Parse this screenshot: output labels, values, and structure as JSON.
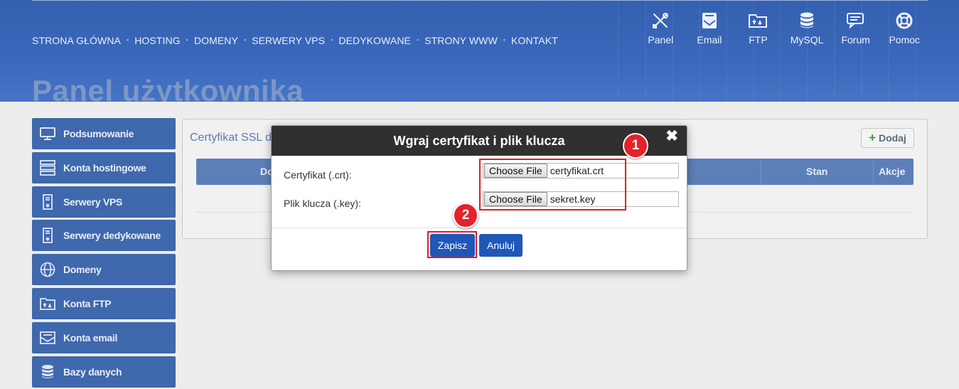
{
  "header": {
    "nav": [
      "STRONA GŁÓWNA",
      "HOSTING",
      "DOMENY",
      "SERWERY VPS",
      "DEDYKOWANE",
      "STRONY WWW",
      "KONTAKT"
    ],
    "nav_separator": "▪",
    "tools": [
      {
        "label": "Panel",
        "icon": "tools-icon"
      },
      {
        "label": "Email",
        "icon": "email-icon"
      },
      {
        "label": "FTP",
        "icon": "ftp-folder-icon"
      },
      {
        "label": "MySQL",
        "icon": "database-icon"
      },
      {
        "label": "Forum",
        "icon": "forum-icon"
      },
      {
        "label": "Pomoc",
        "icon": "lifebuoy-icon"
      }
    ],
    "page_title": "Panel użytkownika"
  },
  "sidebar": {
    "items": [
      {
        "label": "Podsumowanie",
        "icon": "monitor-icon"
      },
      {
        "label": "Konta hostingowe",
        "icon": "server-stack-icon"
      },
      {
        "label": "Serwery VPS",
        "icon": "server-tower-icon"
      },
      {
        "label": "Serwery dedykowane",
        "icon": "server-tower-icon"
      },
      {
        "label": "Domeny",
        "icon": "www-globe-icon"
      },
      {
        "label": "Konta FTP",
        "icon": "ftp-folder-icon"
      },
      {
        "label": "Konta email",
        "icon": "envelope-icon"
      },
      {
        "label": "Bazy danych",
        "icon": "database-icon"
      }
    ]
  },
  "panel": {
    "title": "Certyfikat SSL d",
    "add_label": "Dodaj",
    "add_icon": "plus-icon",
    "columns": {
      "first": "Do",
      "status": "Stan",
      "actions": "Akcje"
    }
  },
  "modal": {
    "title": "Wgraj certyfikat i plik klucza",
    "close_glyph": "✖",
    "cert_label": "Certyfikat (.crt):",
    "key_label": "Plik klucza (.key):",
    "choose_file_label": "Choose File",
    "cert_file": "certyfikat.crt",
    "key_file": "sekret.key",
    "save_label": "Zapisz",
    "cancel_label": "Anuluj"
  },
  "annotations": {
    "badge1": "1",
    "badge2": "2"
  },
  "colors": {
    "header_blue": "#3a68bb",
    "sidebar_blue": "#3f68ad",
    "primary_button": "#1f57b8",
    "annotation_red": "#e5212a"
  }
}
